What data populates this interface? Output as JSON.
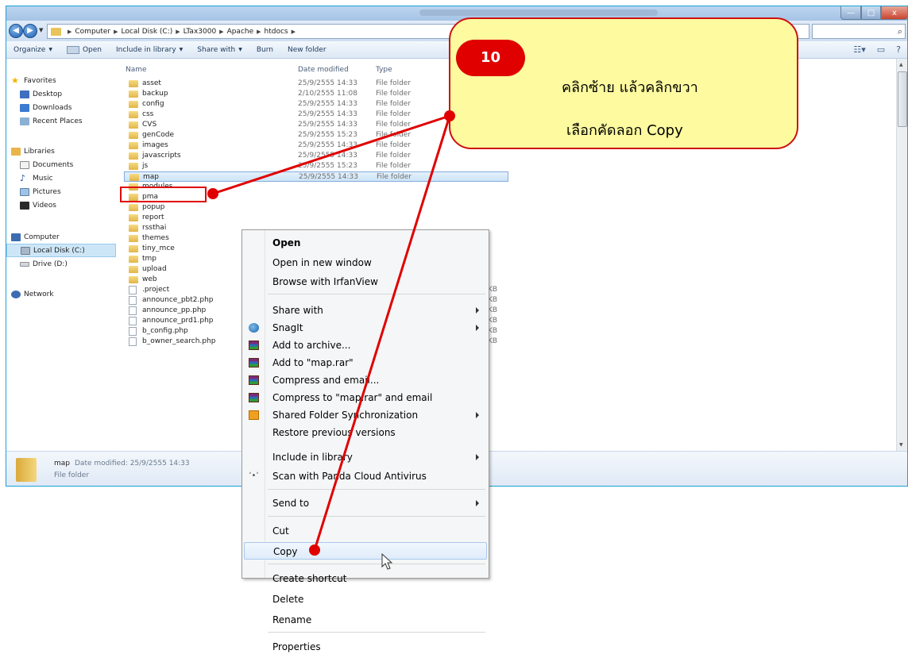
{
  "window": {
    "controls": {
      "minimize": "—",
      "maximize": "□",
      "close": "x"
    }
  },
  "address": {
    "breadcrumbs": [
      "Computer",
      "Local Disk (C:)",
      "LTax3000",
      "Apache",
      "htdocs"
    ],
    "search_placeholder": ""
  },
  "toolbar": {
    "organize": "Organize",
    "open": "Open",
    "include_in_library": "Include in library",
    "share_with": "Share with",
    "burn": "Burn",
    "new_folder": "New folder"
  },
  "navpane": {
    "favorites": "Favorites",
    "desktop": "Desktop",
    "downloads": "Downloads",
    "recent_places": "Recent Places",
    "libraries": "Libraries",
    "documents": "Documents",
    "music": "Music",
    "pictures": "Pictures",
    "videos": "Videos",
    "computer": "Computer",
    "local_disk": "Local Disk (C:)",
    "drive_d": "Drive (D:)",
    "network": "Network"
  },
  "columns": {
    "name": "Name",
    "date_modified": "Date modified",
    "type": "Type"
  },
  "files": [
    {
      "name": "asset",
      "date": "25/9/2555 14:33",
      "type": "File folder",
      "kind": "folder"
    },
    {
      "name": "backup",
      "date": "2/10/2555 11:08",
      "type": "File folder",
      "kind": "folder"
    },
    {
      "name": "config",
      "date": "25/9/2555 14:33",
      "type": "File folder",
      "kind": "folder"
    },
    {
      "name": "css",
      "date": "25/9/2555 14:33",
      "type": "File folder",
      "kind": "folder"
    },
    {
      "name": "CVS",
      "date": "25/9/2555 14:33",
      "type": "File folder",
      "kind": "folder"
    },
    {
      "name": "genCode",
      "date": "25/9/2555 15:23",
      "type": "File folder",
      "kind": "folder"
    },
    {
      "name": "images",
      "date": "25/9/2555 14:33",
      "type": "File folder",
      "kind": "folder"
    },
    {
      "name": "javascripts",
      "date": "25/9/2555 14:33",
      "type": "File folder",
      "kind": "folder"
    },
    {
      "name": "js",
      "date": "25/9/2555 15:23",
      "type": "File folder",
      "kind": "folder"
    },
    {
      "name": "map",
      "date": "25/9/2555 14:33",
      "type": "File folder",
      "kind": "folder",
      "selected": true
    },
    {
      "name": "modules",
      "date": "",
      "type": "",
      "kind": "folder"
    },
    {
      "name": "pma",
      "date": "",
      "type": "",
      "kind": "folder"
    },
    {
      "name": "popup",
      "date": "",
      "type": "",
      "kind": "folder"
    },
    {
      "name": "report",
      "date": "",
      "type": "",
      "kind": "folder"
    },
    {
      "name": "rssthai",
      "date": "",
      "type": "",
      "kind": "folder"
    },
    {
      "name": "themes",
      "date": "",
      "type": "",
      "kind": "folder"
    },
    {
      "name": "tiny_mce",
      "date": "",
      "type": "",
      "kind": "folder"
    },
    {
      "name": "tmp",
      "date": "",
      "type": "",
      "kind": "folder"
    },
    {
      "name": "upload",
      "date": "",
      "type": "",
      "kind": "folder"
    },
    {
      "name": "web",
      "date": "",
      "type": "",
      "kind": "folder"
    },
    {
      "name": ".project",
      "date": "",
      "type": "",
      "size": "KB",
      "kind": "file"
    },
    {
      "name": "announce_pbt2.php",
      "date": "",
      "type": "",
      "size": "KB",
      "kind": "file"
    },
    {
      "name": "announce_pp.php",
      "date": "",
      "type": "",
      "size": "KB",
      "kind": "file"
    },
    {
      "name": "announce_prd1.php",
      "date": "",
      "type": "",
      "size": "KB",
      "kind": "file"
    },
    {
      "name": "b_config.php",
      "date": "",
      "type": "",
      "size": "KB",
      "kind": "file"
    },
    {
      "name": "b_owner_search.php",
      "date": "",
      "type": "",
      "size": "KB",
      "kind": "file"
    }
  ],
  "details": {
    "name": "map",
    "date_label": "Date modified:",
    "date_value": "25/9/2555 14:33",
    "type": "File folder"
  },
  "context_menu": {
    "open": "Open",
    "open_new_window": "Open in new window",
    "browse_irfanview": "Browse with IrfanView",
    "share_with": "Share with",
    "snagit": "SnagIt",
    "add_archive": "Add to archive...",
    "add_map_rar": "Add to \"map.rar\"",
    "compress_email": "Compress and email...",
    "compress_map_rar_email": "Compress to \"map.rar\" and email",
    "shared_folder_sync": "Shared Folder Synchronization",
    "restore_previous": "Restore previous versions",
    "include_library": "Include in library",
    "scan_panda": "Scan with Panda Cloud Antivirus",
    "send_to": "Send to",
    "cut": "Cut",
    "copy": "Copy",
    "create_shortcut": "Create shortcut",
    "delete": "Delete",
    "rename": "Rename",
    "properties": "Properties"
  },
  "callout": {
    "step": "10",
    "line1": "คลิกซ้าย  แล้วคลิกขวา",
    "line2": "เลือกคัดลอก Copy"
  },
  "colors": {
    "annotation_red": "#e00000",
    "callout_fill": "#fdfa9f",
    "selection_blue": "#cde4f7",
    "window_border": "#1aa3d6"
  }
}
